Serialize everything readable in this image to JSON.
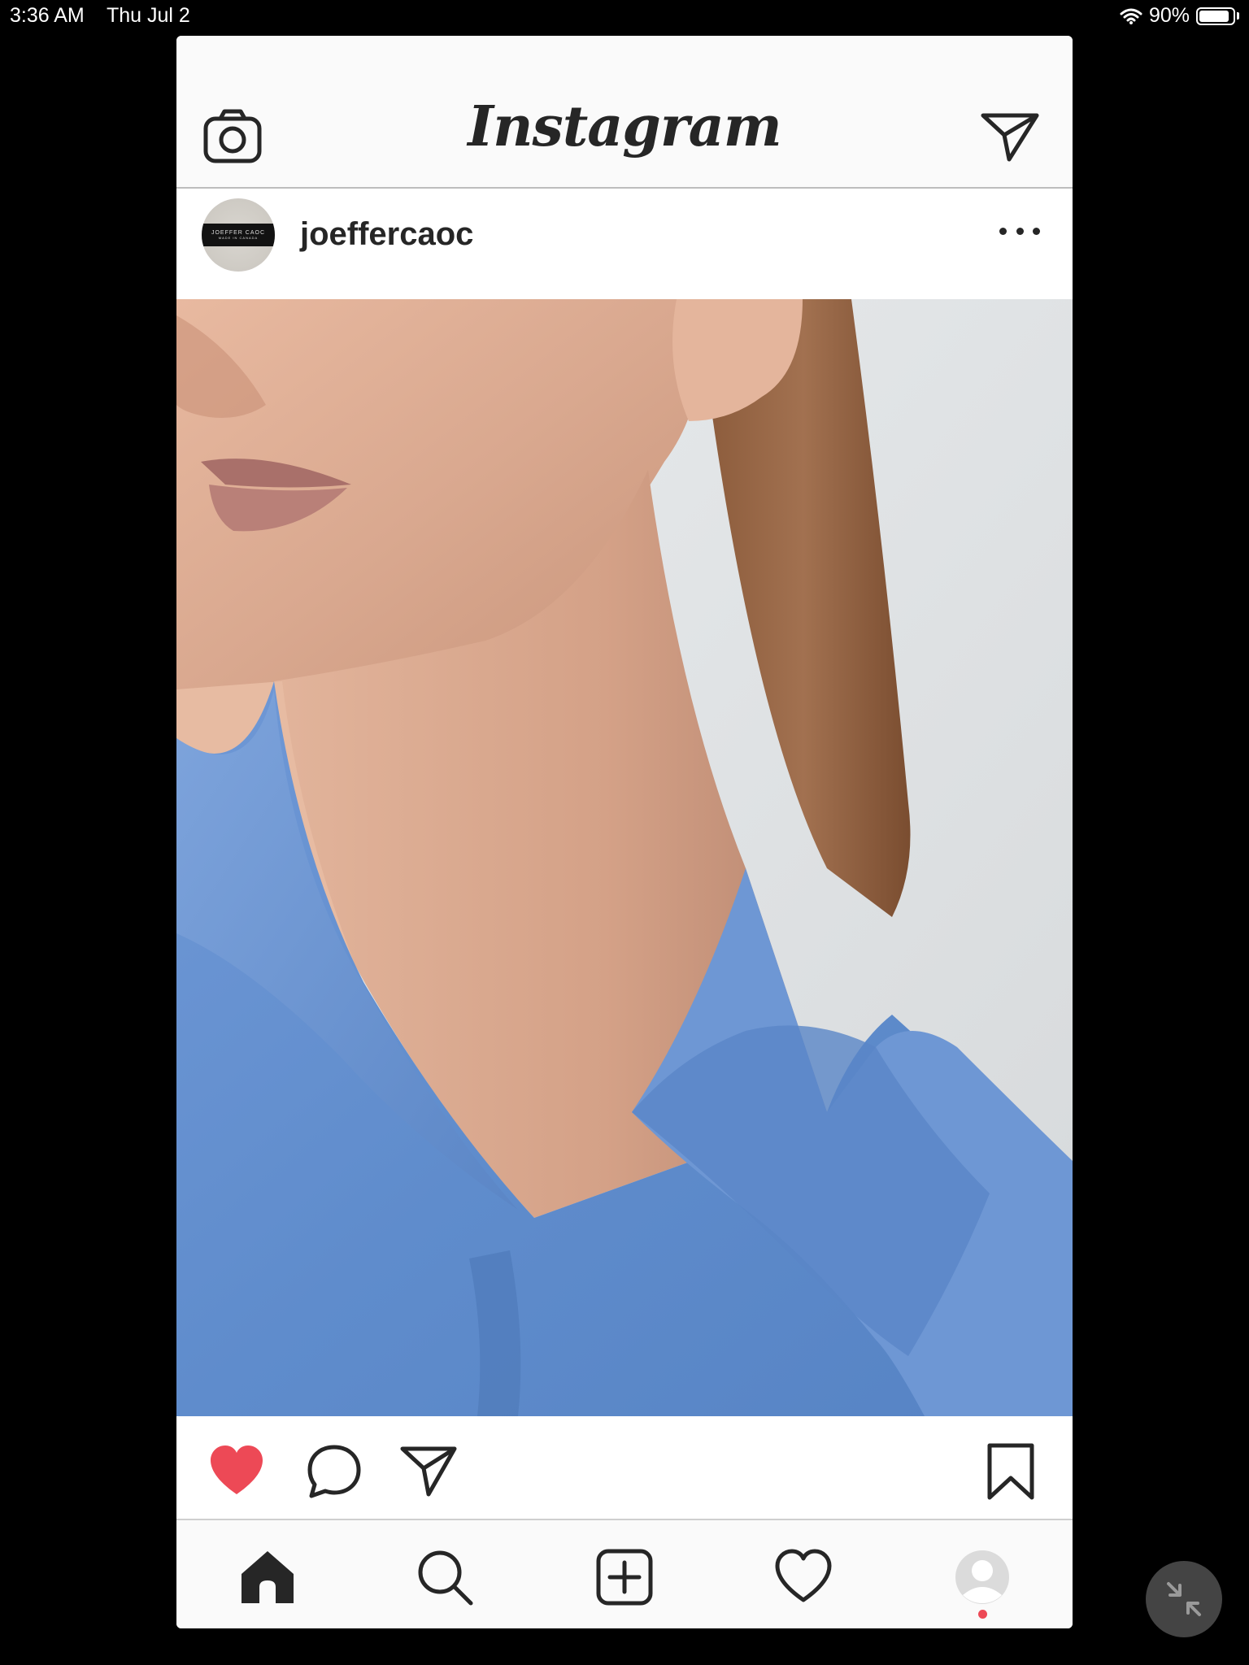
{
  "status": {
    "time": "3:36 AM",
    "date": "Thu Jul 2",
    "battery_text": "90%",
    "battery_level": 0.9
  },
  "header": {
    "brand": "Instagram",
    "camera_icon": "camera-icon",
    "direct_icon": "paper-plane-icon"
  },
  "post": {
    "username": "joeffercaoc",
    "avatar_text": "JOEFFER CAOC",
    "avatar_subtext": "MADE IN CANADA",
    "liked": true,
    "colors": {
      "like": "#ed4956",
      "text": "#262626"
    }
  },
  "tabs": [
    "home-icon",
    "search-icon",
    "add-icon",
    "heart-icon",
    "profile-icon"
  ]
}
